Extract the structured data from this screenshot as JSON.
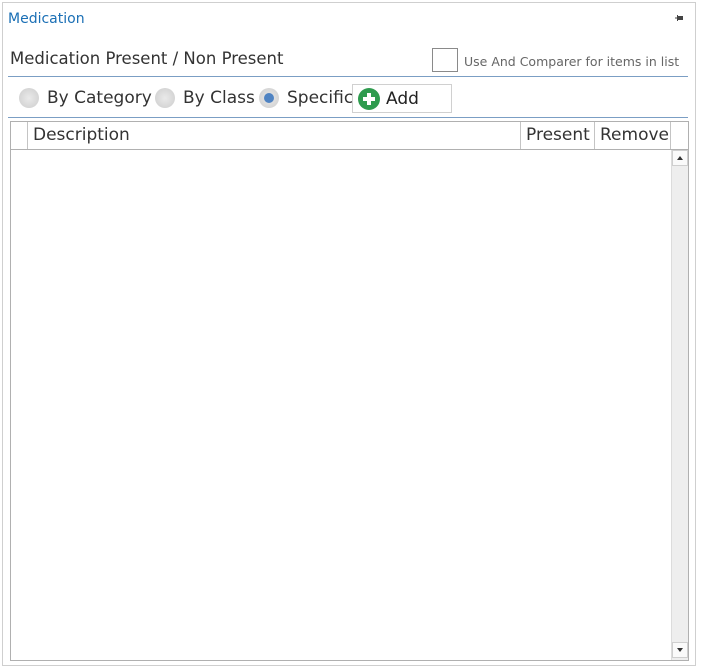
{
  "panel": {
    "title": "Medication",
    "pin_icon": "pin-icon"
  },
  "section": {
    "title": "Medication Present / Non Present",
    "and_comparer_label": "Use And Comparer for items in list",
    "and_comparer_checked": false
  },
  "filter": {
    "options": [
      {
        "label": "By Category",
        "checked": false
      },
      {
        "label": "By Class",
        "checked": false
      },
      {
        "label": "Specific",
        "checked": true
      }
    ],
    "add_label": "Add",
    "add_icon": "plus-circle-icon",
    "add_icon_color": "#2e9b4e"
  },
  "grid": {
    "columns": [
      "Description",
      "Present",
      "Remove"
    ],
    "rows": []
  },
  "colors": {
    "accent": "#1a6fb5",
    "separator": "#7b9ec4",
    "radio_selected": "#4f83c2"
  }
}
